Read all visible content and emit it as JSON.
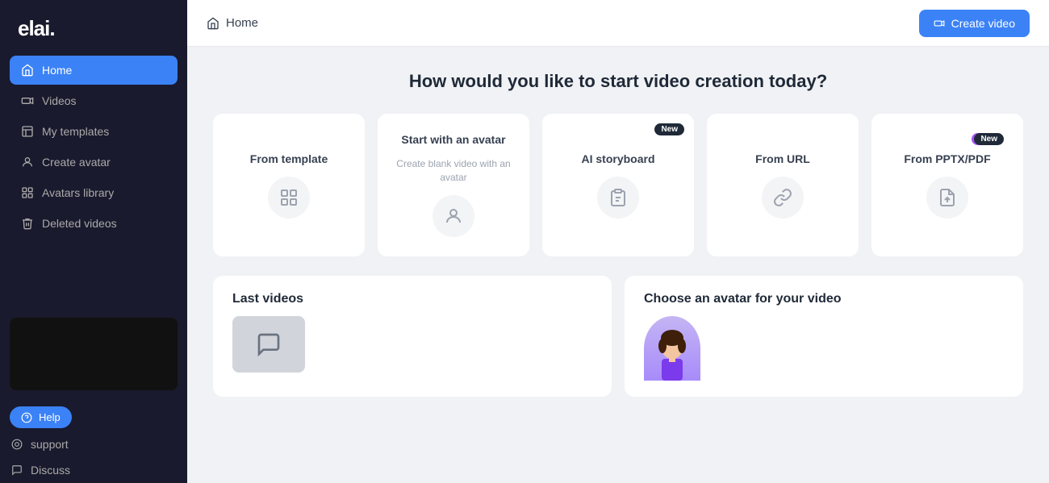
{
  "brand": {
    "logo": "elai.",
    "dot": "."
  },
  "sidebar": {
    "nav_items": [
      {
        "id": "home",
        "label": "Home",
        "active": true,
        "icon": "home"
      },
      {
        "id": "videos",
        "label": "Videos",
        "active": false,
        "icon": "video"
      },
      {
        "id": "my-templates",
        "label": "My templates",
        "active": false,
        "icon": "template"
      },
      {
        "id": "create-avatar",
        "label": "Create avatar",
        "active": false,
        "icon": "person"
      },
      {
        "id": "avatars-library",
        "label": "Avatars library",
        "active": false,
        "icon": "library"
      },
      {
        "id": "deleted-videos",
        "label": "Deleted videos",
        "active": false,
        "icon": "trash"
      }
    ],
    "help_label": "Help",
    "bottom_links": [
      {
        "id": "support",
        "label": "support"
      },
      {
        "id": "discuss",
        "label": "Discuss"
      }
    ]
  },
  "header": {
    "breadcrumb": "Home",
    "create_video_label": "Create video"
  },
  "main": {
    "section_title": "How would you like to start video\ncreation today?",
    "cards": [
      {
        "id": "from-template",
        "title": "From template",
        "subtitle": "",
        "icon": "grid",
        "badge": null,
        "badge_beta": false,
        "badge_new": false
      },
      {
        "id": "start-with-avatar",
        "title": "Start with an avatar",
        "subtitle": "Create blank video with an avatar",
        "icon": "person-circle",
        "badge": null,
        "badge_beta": false,
        "badge_new": false
      },
      {
        "id": "ai-storyboard",
        "title": "AI storyboard",
        "subtitle": "",
        "icon": "clipboard",
        "badge": "New",
        "badge_beta": false,
        "badge_new": true
      },
      {
        "id": "from-url",
        "title": "From URL",
        "subtitle": "",
        "icon": "link",
        "badge": null,
        "badge_beta": false,
        "badge_new": false
      },
      {
        "id": "from-pptx",
        "title": "From PPTX/PDF",
        "subtitle": "",
        "icon": "upload",
        "badge_beta": true,
        "badge_new": true
      }
    ],
    "bottom_sections": [
      {
        "id": "last-videos",
        "title": "Last videos"
      },
      {
        "id": "choose-avatar",
        "title": "Choose an avatar for your video"
      }
    ]
  }
}
